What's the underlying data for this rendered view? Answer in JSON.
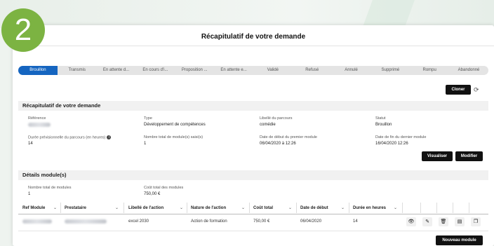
{
  "step_badge": "2",
  "panel_title": "Récapitulatif de votre demande",
  "stepper": [
    "Brouillon",
    "Transmis",
    "En attente d...",
    "En cours d'i...",
    "Proposition ...",
    "En attente e...",
    "Validé",
    "Refusé",
    "Annulé",
    "Supprimé",
    "Rompu",
    "Abandonné"
  ],
  "clone_button": "Cloner",
  "summary": {
    "heading": "Récapitulatif de votre demande",
    "reference_label": "Référence",
    "type_label": "Type",
    "type_value": "Développement de compétences",
    "libelle_label": "Libellé du parcours",
    "libelle_value": "comédie",
    "statut_label": "Statut",
    "statut_value": "Brouillon",
    "duree_label": "Durée prévisionnelle du parcours (en heures)",
    "duree_value": "14",
    "nb_modules_label": "Nombre total de module(s) saisi(s)",
    "nb_modules_value": "1",
    "date_debut_label": "Date de début du premier module",
    "date_debut_value": "06/04/2020 à 12:26",
    "date_fin_label": "Date de fin du dernier module",
    "date_fin_value": "16/04/2020 12:26",
    "visualiser_button": "Visualiser",
    "modifier_button": "Modifier"
  },
  "modules": {
    "heading": "Détails module(s)",
    "total_label": "Nombre total de modules",
    "total_value": "1",
    "cout_label": "Coût total des modules",
    "cout_value": "750,00 €",
    "columns": [
      "Ref Module",
      "Prestataire",
      "Libellé de l'action",
      "Nature de l'action",
      "Coût total",
      "Date de début",
      "Durée en heures"
    ],
    "row": {
      "libelle": "excel 2030",
      "nature": "Action de formation",
      "cout": "750,00 €",
      "date": "06/04/2020",
      "duree": "14"
    },
    "new_button": "Nouveau module"
  },
  "icons": [
    "eye-icon",
    "pencil-icon",
    "trash-icon",
    "document-icon",
    "copy-icon",
    "refresh-icon",
    "info-icon",
    "chevron-down-icon"
  ]
}
